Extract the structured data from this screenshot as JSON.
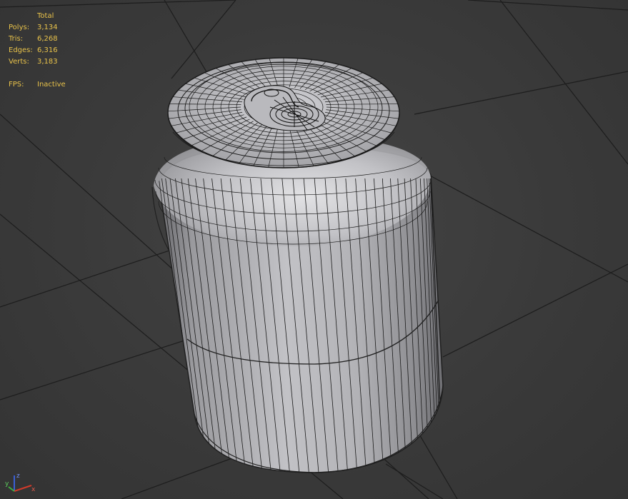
{
  "viewport": {
    "stats": {
      "header": "Total",
      "rows": [
        {
          "label": "Polys:",
          "value": "3,134"
        },
        {
          "label": "Tris:",
          "value": "6,268"
        },
        {
          "label": "Edges:",
          "value": "6,316"
        },
        {
          "label": "Verts:",
          "value": "3,183"
        }
      ],
      "fps": {
        "label": "FPS:",
        "value": "Inactive"
      }
    },
    "axis_gizmo": {
      "x_label": "x",
      "y_label": "y",
      "z_label": "z",
      "colors": {
        "x": "#d23a2a",
        "y": "#3fae3f",
        "z": "#3a5fd6"
      }
    },
    "colors": {
      "background": "#3b3b3b",
      "grid": "#1c1c1c",
      "stats_text": "#e8c24a",
      "mesh_wire": "#1a1a1a",
      "mesh_surface": "#a9a9ad"
    },
    "object": {
      "name_icon": "soda-can-mesh",
      "display_mode": "shaded-wireframe"
    }
  }
}
